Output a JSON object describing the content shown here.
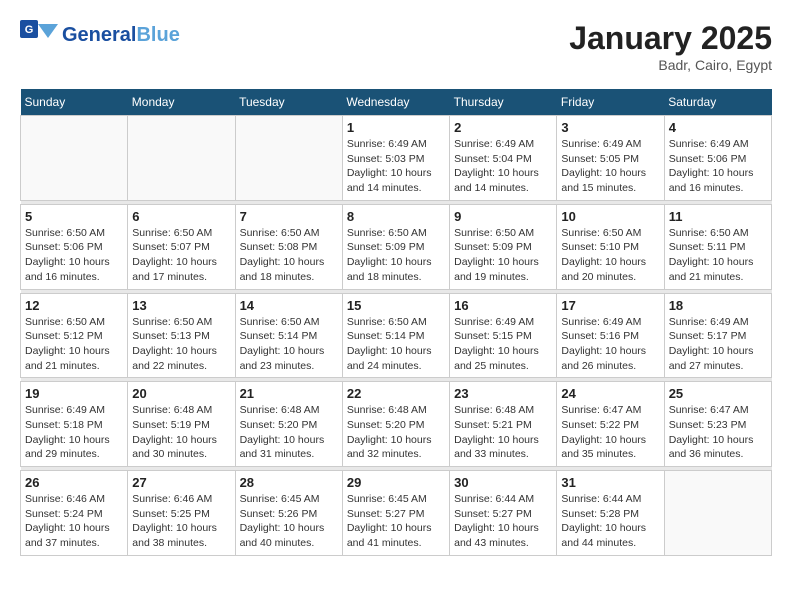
{
  "header": {
    "logo_line1": "General",
    "logo_line2": "Blue",
    "month": "January 2025",
    "location": "Badr, Cairo, Egypt"
  },
  "days_of_week": [
    "Sunday",
    "Monday",
    "Tuesday",
    "Wednesday",
    "Thursday",
    "Friday",
    "Saturday"
  ],
  "weeks": [
    [
      {
        "day": "",
        "info": ""
      },
      {
        "day": "",
        "info": ""
      },
      {
        "day": "",
        "info": ""
      },
      {
        "day": "1",
        "info": "Sunrise: 6:49 AM\nSunset: 5:03 PM\nDaylight: 10 hours and 14 minutes."
      },
      {
        "day": "2",
        "info": "Sunrise: 6:49 AM\nSunset: 5:04 PM\nDaylight: 10 hours and 14 minutes."
      },
      {
        "day": "3",
        "info": "Sunrise: 6:49 AM\nSunset: 5:05 PM\nDaylight: 10 hours and 15 minutes."
      },
      {
        "day": "4",
        "info": "Sunrise: 6:49 AM\nSunset: 5:06 PM\nDaylight: 10 hours and 16 minutes."
      }
    ],
    [
      {
        "day": "5",
        "info": "Sunrise: 6:50 AM\nSunset: 5:06 PM\nDaylight: 10 hours and 16 minutes."
      },
      {
        "day": "6",
        "info": "Sunrise: 6:50 AM\nSunset: 5:07 PM\nDaylight: 10 hours and 17 minutes."
      },
      {
        "day": "7",
        "info": "Sunrise: 6:50 AM\nSunset: 5:08 PM\nDaylight: 10 hours and 18 minutes."
      },
      {
        "day": "8",
        "info": "Sunrise: 6:50 AM\nSunset: 5:09 PM\nDaylight: 10 hours and 18 minutes."
      },
      {
        "day": "9",
        "info": "Sunrise: 6:50 AM\nSunset: 5:09 PM\nDaylight: 10 hours and 19 minutes."
      },
      {
        "day": "10",
        "info": "Sunrise: 6:50 AM\nSunset: 5:10 PM\nDaylight: 10 hours and 20 minutes."
      },
      {
        "day": "11",
        "info": "Sunrise: 6:50 AM\nSunset: 5:11 PM\nDaylight: 10 hours and 21 minutes."
      }
    ],
    [
      {
        "day": "12",
        "info": "Sunrise: 6:50 AM\nSunset: 5:12 PM\nDaylight: 10 hours and 21 minutes."
      },
      {
        "day": "13",
        "info": "Sunrise: 6:50 AM\nSunset: 5:13 PM\nDaylight: 10 hours and 22 minutes."
      },
      {
        "day": "14",
        "info": "Sunrise: 6:50 AM\nSunset: 5:14 PM\nDaylight: 10 hours and 23 minutes."
      },
      {
        "day": "15",
        "info": "Sunrise: 6:50 AM\nSunset: 5:14 PM\nDaylight: 10 hours and 24 minutes."
      },
      {
        "day": "16",
        "info": "Sunrise: 6:49 AM\nSunset: 5:15 PM\nDaylight: 10 hours and 25 minutes."
      },
      {
        "day": "17",
        "info": "Sunrise: 6:49 AM\nSunset: 5:16 PM\nDaylight: 10 hours and 26 minutes."
      },
      {
        "day": "18",
        "info": "Sunrise: 6:49 AM\nSunset: 5:17 PM\nDaylight: 10 hours and 27 minutes."
      }
    ],
    [
      {
        "day": "19",
        "info": "Sunrise: 6:49 AM\nSunset: 5:18 PM\nDaylight: 10 hours and 29 minutes."
      },
      {
        "day": "20",
        "info": "Sunrise: 6:48 AM\nSunset: 5:19 PM\nDaylight: 10 hours and 30 minutes."
      },
      {
        "day": "21",
        "info": "Sunrise: 6:48 AM\nSunset: 5:20 PM\nDaylight: 10 hours and 31 minutes."
      },
      {
        "day": "22",
        "info": "Sunrise: 6:48 AM\nSunset: 5:20 PM\nDaylight: 10 hours and 32 minutes."
      },
      {
        "day": "23",
        "info": "Sunrise: 6:48 AM\nSunset: 5:21 PM\nDaylight: 10 hours and 33 minutes."
      },
      {
        "day": "24",
        "info": "Sunrise: 6:47 AM\nSunset: 5:22 PM\nDaylight: 10 hours and 35 minutes."
      },
      {
        "day": "25",
        "info": "Sunrise: 6:47 AM\nSunset: 5:23 PM\nDaylight: 10 hours and 36 minutes."
      }
    ],
    [
      {
        "day": "26",
        "info": "Sunrise: 6:46 AM\nSunset: 5:24 PM\nDaylight: 10 hours and 37 minutes."
      },
      {
        "day": "27",
        "info": "Sunrise: 6:46 AM\nSunset: 5:25 PM\nDaylight: 10 hours and 38 minutes."
      },
      {
        "day": "28",
        "info": "Sunrise: 6:45 AM\nSunset: 5:26 PM\nDaylight: 10 hours and 40 minutes."
      },
      {
        "day": "29",
        "info": "Sunrise: 6:45 AM\nSunset: 5:27 PM\nDaylight: 10 hours and 41 minutes."
      },
      {
        "day": "30",
        "info": "Sunrise: 6:44 AM\nSunset: 5:27 PM\nDaylight: 10 hours and 43 minutes."
      },
      {
        "day": "31",
        "info": "Sunrise: 6:44 AM\nSunset: 5:28 PM\nDaylight: 10 hours and 44 minutes."
      },
      {
        "day": "",
        "info": ""
      }
    ]
  ]
}
